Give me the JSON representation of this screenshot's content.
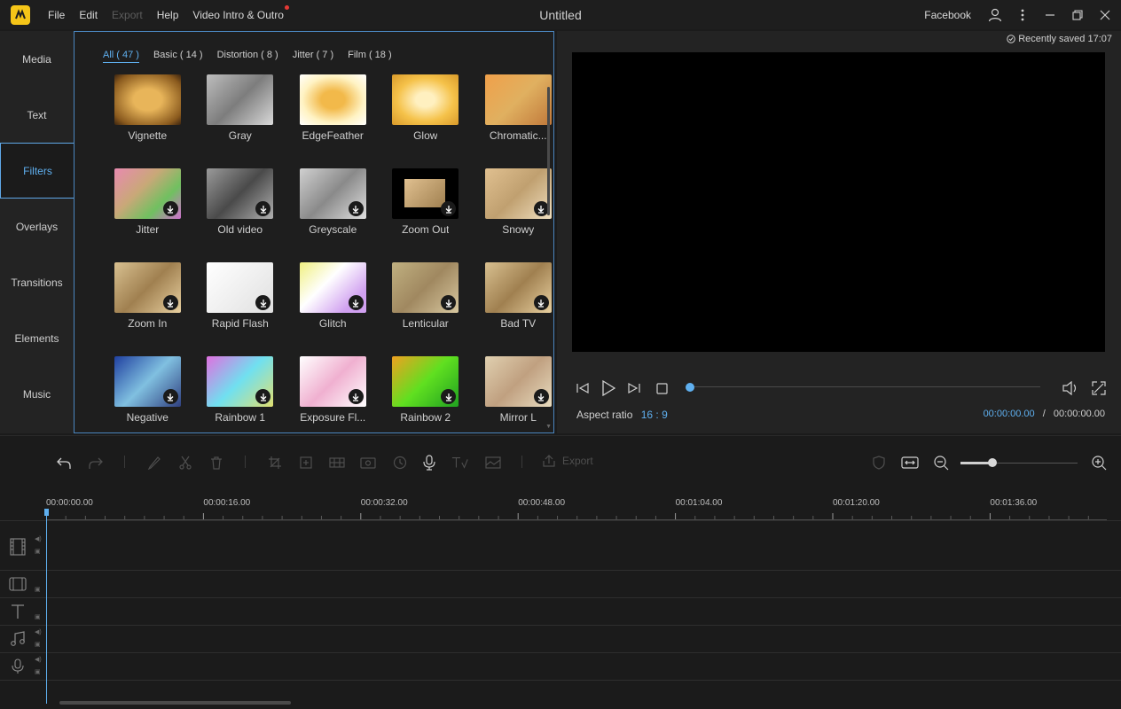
{
  "app": {
    "title": "Untitled",
    "logo_icon": "app-logo-icon",
    "menu": [
      {
        "label": "File",
        "enabled": true
      },
      {
        "label": "Edit",
        "enabled": true
      },
      {
        "label": "Export",
        "enabled": false
      },
      {
        "label": "Help",
        "enabled": true
      },
      {
        "label": "Video Intro & Outro",
        "enabled": true,
        "badge": true
      }
    ],
    "account": "Facebook"
  },
  "sidebar": {
    "items": [
      {
        "label": "Media"
      },
      {
        "label": "Text"
      },
      {
        "label": "Filters",
        "active": true
      },
      {
        "label": "Overlays"
      },
      {
        "label": "Transitions"
      },
      {
        "label": "Elements"
      },
      {
        "label": "Music"
      }
    ]
  },
  "filters": {
    "tabs": [
      {
        "label": "All ( 47 )",
        "active": true
      },
      {
        "label": "Basic ( 14 )"
      },
      {
        "label": "Distortion ( 8 )"
      },
      {
        "label": "Jitter ( 7 )"
      },
      {
        "label": "Film ( 18 )"
      }
    ],
    "items": [
      {
        "label": "Vignette",
        "download": false,
        "style": "vignette"
      },
      {
        "label": "Gray",
        "download": false,
        "style": "gray"
      },
      {
        "label": "EdgeFeather",
        "download": false,
        "style": "edge"
      },
      {
        "label": "Glow",
        "download": false,
        "style": "glow"
      },
      {
        "label": "Chromatic...",
        "download": false,
        "style": "chromatic"
      },
      {
        "label": "Jitter",
        "download": true,
        "style": "jitter"
      },
      {
        "label": "Old video",
        "download": true,
        "style": "old"
      },
      {
        "label": "Greyscale",
        "download": true,
        "style": "grey"
      },
      {
        "label": "Zoom Out",
        "download": true,
        "style": "zoomout"
      },
      {
        "label": "Snowy",
        "download": true,
        "style": "snowy"
      },
      {
        "label": "Zoom In",
        "download": true,
        "style": "zoomin"
      },
      {
        "label": "Rapid Flash",
        "download": true,
        "style": "flash"
      },
      {
        "label": "Glitch",
        "download": true,
        "style": "glitch"
      },
      {
        "label": "Lenticular",
        "download": true,
        "style": "lenti"
      },
      {
        "label": "Bad TV",
        "download": true,
        "style": "badtv"
      },
      {
        "label": "Negative",
        "download": true,
        "style": "negative"
      },
      {
        "label": "Rainbow 1",
        "download": true,
        "style": "rainbow1"
      },
      {
        "label": "Exposure Fl...",
        "download": true,
        "style": "exposure"
      },
      {
        "label": "Rainbow 2",
        "download": true,
        "style": "rainbow2"
      },
      {
        "label": "Mirror L",
        "download": true,
        "style": "mirror"
      }
    ]
  },
  "preview": {
    "saved_text": "Recently saved 17:07",
    "aspect_label": "Aspect ratio",
    "aspect_value": "16 : 9",
    "current_time": "00:00:00.00",
    "time_separator": "/",
    "total_time": "00:00:00.00",
    "progress": 0
  },
  "toolbar": {
    "export_label": "Export",
    "zoom_level": 0.27
  },
  "timeline": {
    "ruler_labels": [
      "00:00:00.00",
      "00:00:16.00",
      "00:00:32.00",
      "00:00:48.00",
      "00:01:04.00",
      "00:01:20.00",
      "00:01:36.00"
    ],
    "tracks": [
      "video-track",
      "overlay-track",
      "text-track",
      "music-track",
      "voice-track"
    ]
  }
}
